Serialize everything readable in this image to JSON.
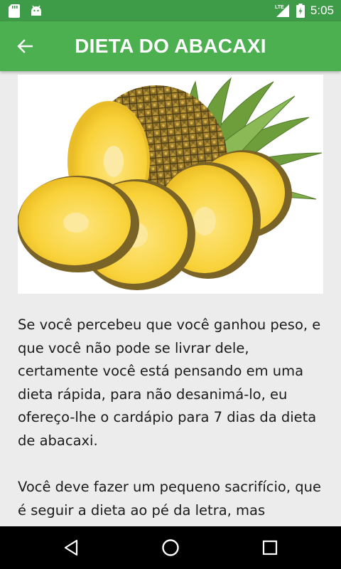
{
  "status_bar": {
    "time": "5:05",
    "network": "LTE"
  },
  "header": {
    "title": "DIETA DO ABACAXI"
  },
  "article": {
    "paragraphs": [
      "Se você percebeu que você ganhou peso, e que você não pode se livrar dele, certamente você está pensando em uma dieta rápida, para não desanimá-lo, eu ofereço-lhe o cardápio para 7 dias da dieta de abacaxi.",
      "Você deve fazer um pequeno sacrifício, que é seguir a dieta ao pé da letra, mas"
    ]
  },
  "colors": {
    "app_bar": "#4CAF50",
    "status_bar": "#3E9B47",
    "background": "#ECECEC"
  },
  "icons": [
    "sd-card-icon",
    "android-icon",
    "signal-icon",
    "battery-icon",
    "back-arrow-icon",
    "nav-back-icon",
    "nav-home-icon",
    "nav-recents-icon"
  ]
}
